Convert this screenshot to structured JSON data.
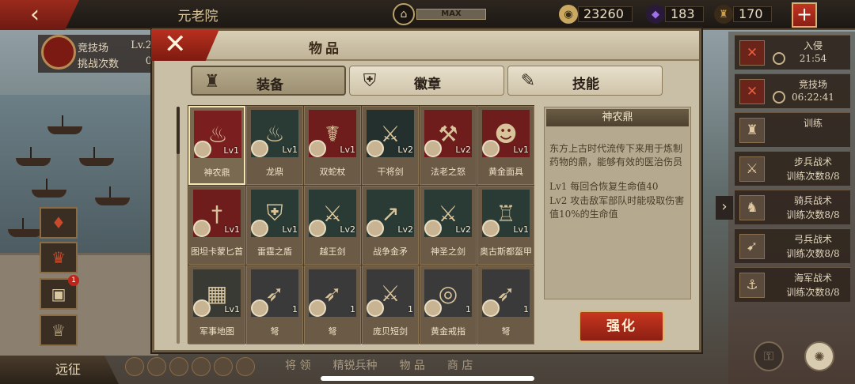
{
  "topbar": {
    "back_icon": "chevron-left-icon",
    "title": "元老院",
    "level_label": "MAX",
    "resources": [
      {
        "icon": "coin-icon",
        "value": "23260",
        "color": "#c9a862"
      },
      {
        "icon": "gem-icon",
        "value": "183",
        "color": "#8a5ad0"
      },
      {
        "icon": "helmet-icon",
        "value": "170",
        "color": "#d0a040"
      }
    ],
    "add_label": "+"
  },
  "left_panel": {
    "arena_label": "竞技场",
    "arena_level": "Lv.2",
    "challenge_label": "挑战次数",
    "challenge_value": "0",
    "notification_count": "1",
    "expedition_label": "远征"
  },
  "bottom_nav": [
    "将 领",
    "精锐兵种",
    "物 品",
    "商 店"
  ],
  "right_panel": {
    "tasks": [
      {
        "icon": "sword-cross-icon",
        "line1": "入侵",
        "line2": "21:54",
        "clock": true,
        "red": true
      },
      {
        "icon": "sword-cross-icon",
        "line1": "竞技场",
        "line2": "06:22:41",
        "clock": true,
        "red": true
      },
      {
        "icon": "helmet-icon",
        "line1": "训练",
        "line2": "",
        "clock": false,
        "red": false
      },
      {
        "icon": "sword-icon",
        "line1": "步兵战术",
        "line2": "训练次数8/8",
        "clock": false,
        "red": false
      },
      {
        "icon": "horse-icon",
        "line1": "骑兵战术",
        "line2": "训练次数8/8",
        "clock": false,
        "red": false
      },
      {
        "icon": "bow-icon",
        "line1": "弓兵战术",
        "line2": "训练次数8/8",
        "clock": false,
        "red": false
      },
      {
        "icon": "anchor-icon",
        "line1": "海军战术",
        "line2": "训练次数8/8",
        "clock": false,
        "red": false
      }
    ]
  },
  "modal": {
    "title": "物品",
    "close_label": "✕",
    "tabs": [
      {
        "label": "装备",
        "icon": "helmet-icon",
        "active": true
      },
      {
        "label": "徽章",
        "icon": "shield-icon",
        "active": false
      },
      {
        "label": "技能",
        "icon": "scroll-icon",
        "active": false
      }
    ],
    "items": [
      {
        "name": "神农鼎",
        "level": "Lv1",
        "icon": "cauldron-icon",
        "selected": true,
        "bg": "#7a1e20"
      },
      {
        "name": "龙鼎",
        "level": "Lv1",
        "icon": "cauldron-icon",
        "selected": false,
        "bg": "#2a3a34"
      },
      {
        "name": "双蛇杖",
        "level": "Lv1",
        "icon": "caduceus-icon",
        "selected": false,
        "bg": "#6e1c1c"
      },
      {
        "name": "干将剑",
        "level": "Lv2",
        "icon": "sword-icon",
        "selected": false,
        "bg": "#24302e"
      },
      {
        "name": "法老之怒",
        "level": "Lv2",
        "icon": "axe-icon",
        "selected": false,
        "bg": "#6e1c1c"
      },
      {
        "name": "黄金面具",
        "level": "Lv1",
        "icon": "mask-icon",
        "selected": false,
        "bg": "#6e1c1c"
      },
      {
        "name": "图坦卡蒙匕首",
        "level": "Lv1",
        "icon": "dagger-icon",
        "selected": false,
        "bg": "#6e1c1c"
      },
      {
        "name": "雷霆之盾",
        "level": "Lv1",
        "icon": "shield-icon",
        "selected": false,
        "bg": "#2a3a34"
      },
      {
        "name": "越王剑",
        "level": "Lv2",
        "icon": "sword-icon",
        "selected": false,
        "bg": "#2a3a34"
      },
      {
        "name": "战争金矛",
        "level": "Lv2",
        "icon": "spear-icon",
        "selected": false,
        "bg": "#2a3a34"
      },
      {
        "name": "神圣之剑",
        "level": "Lv2",
        "icon": "sword-icon",
        "selected": false,
        "bg": "#2a3a34"
      },
      {
        "name": "奥古斯都盔甲",
        "level": "Lv1",
        "icon": "armor-icon",
        "selected": false,
        "bg": "#2a3a34"
      },
      {
        "name": "军事地图",
        "level": "Lv1",
        "icon": "map-icon",
        "selected": false,
        "bg": "#3a3a34"
      },
      {
        "name": "弩",
        "level": "1",
        "icon": "crossbow-icon",
        "selected": false,
        "bg": "#3a3a3a"
      },
      {
        "name": "弩",
        "level": "1",
        "icon": "crossbow-icon",
        "selected": false,
        "bg": "#3a3a3a"
      },
      {
        "name": "庞贝短剑",
        "level": "1",
        "icon": "sword-icon",
        "selected": false,
        "bg": "#3a3a3a"
      },
      {
        "name": "黄金戒指",
        "level": "1",
        "icon": "ring-icon",
        "selected": false,
        "bg": "#3a3a3a"
      },
      {
        "name": "弩",
        "level": "1",
        "icon": "crossbow-icon",
        "selected": false,
        "bg": "#3a3a3a"
      }
    ],
    "detail": {
      "title": "神农鼎",
      "description": "东方上古时代流传下来用于炼制药物的鼎，能够有效的医治伤员",
      "lv1": "Lv1  每回合恢复生命值40",
      "lv2": "Lv2  攻击敌军部队时能吸取伤害值10%的生命值"
    },
    "enhance_label": "强化"
  },
  "colors": {
    "accent_red": "#b8301f",
    "panel_bg": "#c9bfa6",
    "gold_border": "#e2b46a"
  }
}
